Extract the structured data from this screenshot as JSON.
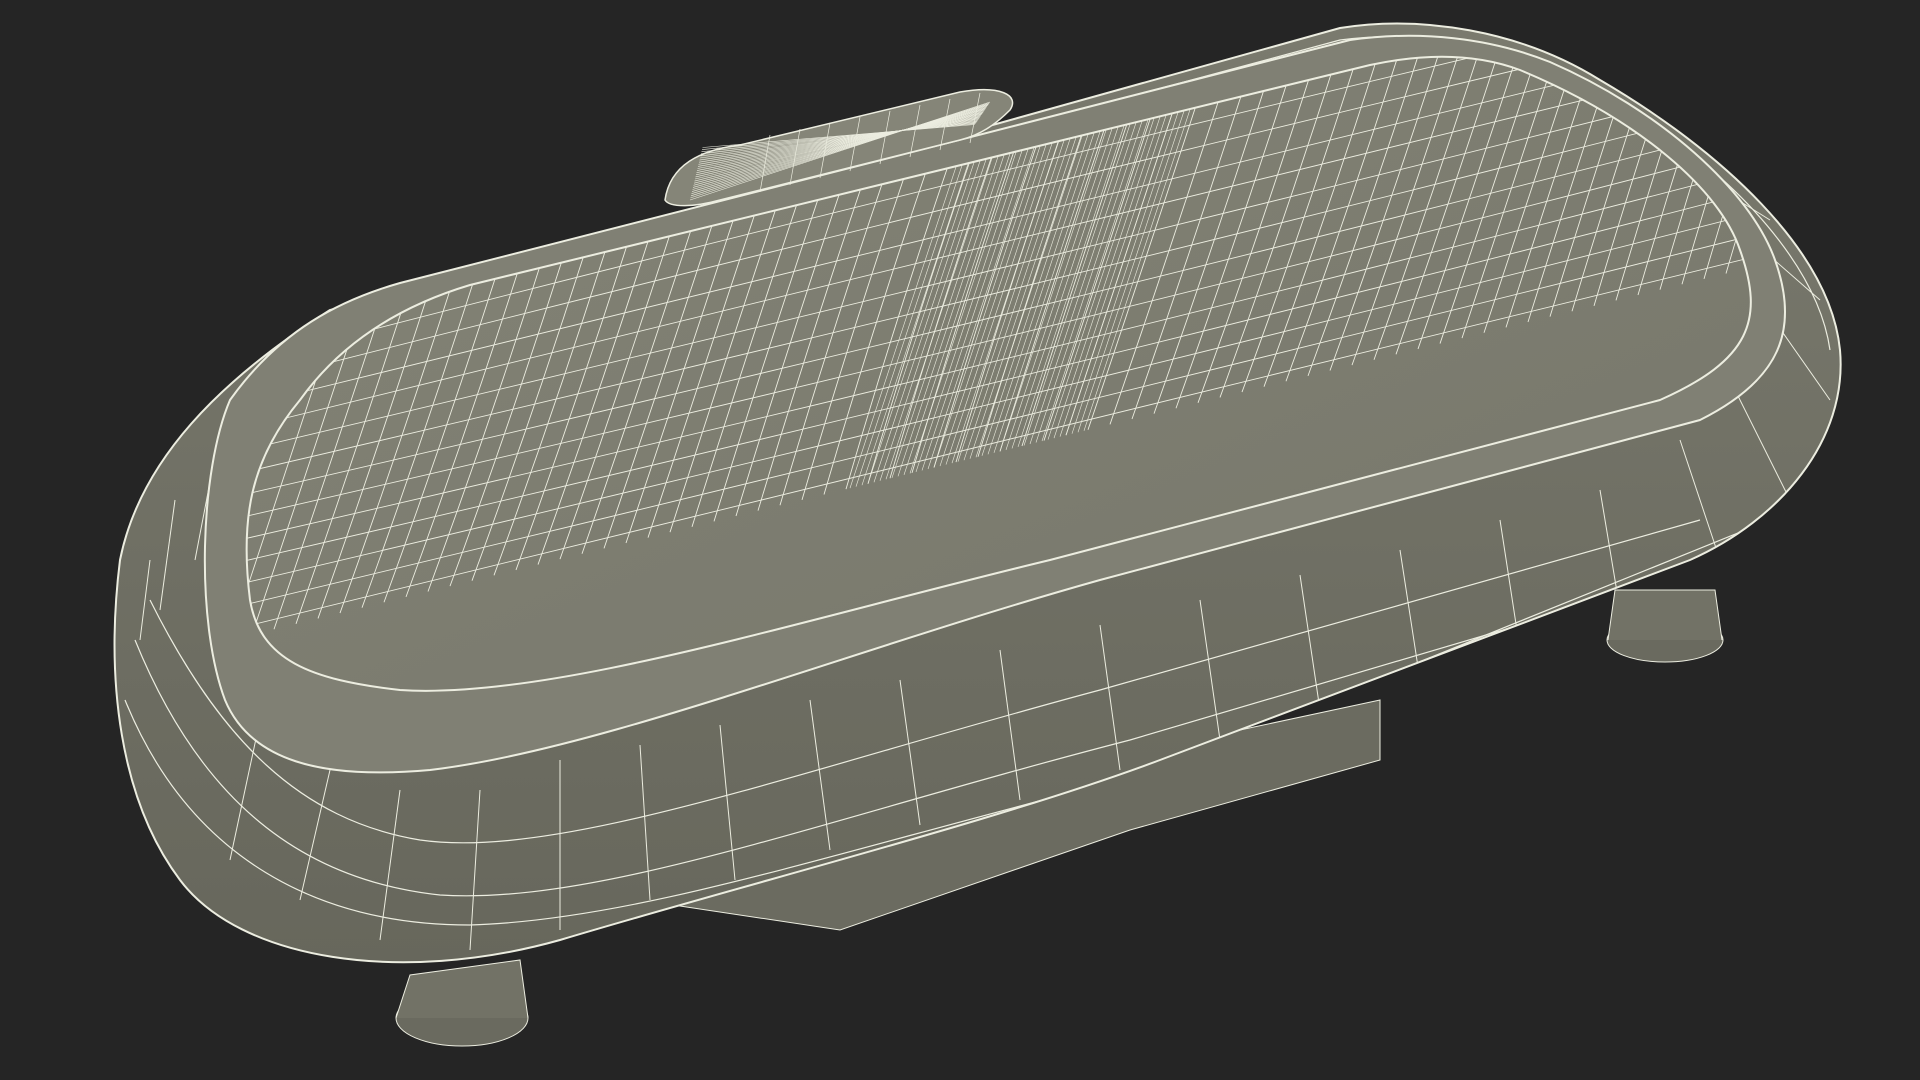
{
  "scene": {
    "background_color": "#252525",
    "surface_color": "#7d7d70",
    "surface_dark_color": "#6c6c60",
    "wire_color": "#ecede0",
    "subject": "wireframe-vibration-plate-model"
  }
}
